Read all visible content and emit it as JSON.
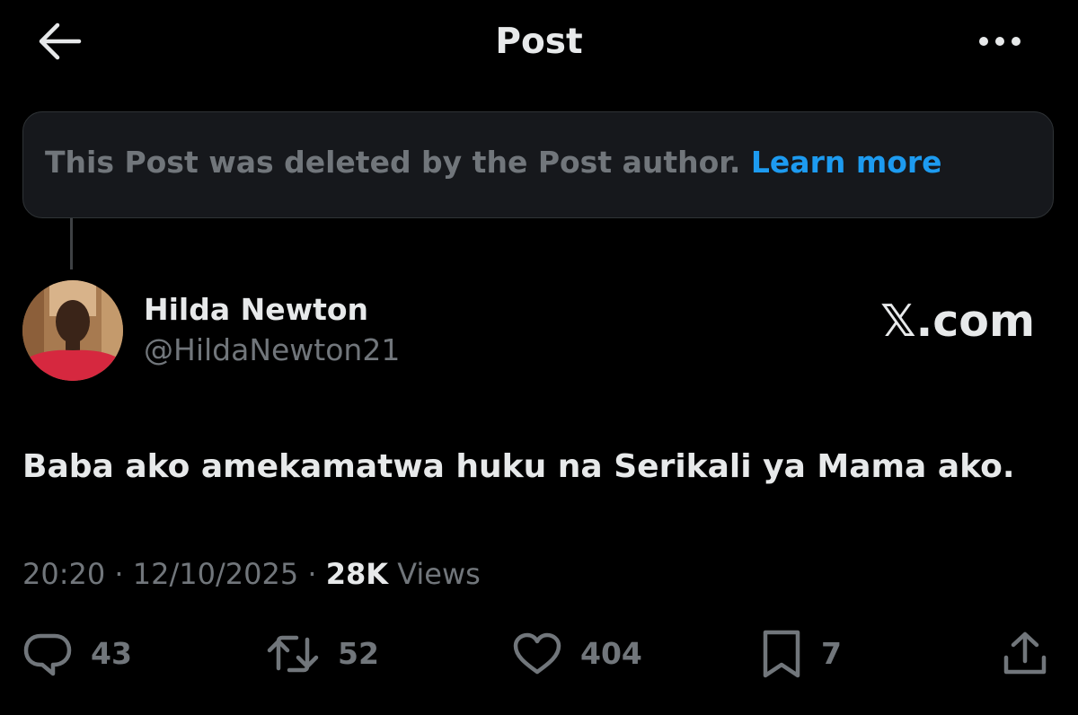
{
  "header": {
    "title": "Post",
    "back_icon": "arrow-left-icon",
    "more_icon": "more-horizontal-icon"
  },
  "deleted_notice": {
    "text": "This Post was deleted by the Post author.",
    "link": "Learn more"
  },
  "author": {
    "name": "Hilda Newton",
    "handle": "@HildaNewton21",
    "avatar_icon": "avatar"
  },
  "watermark": "𝕏.com",
  "post": {
    "text": "Baba ako amekamatwa huku na Serikali ya Mama ako."
  },
  "meta": {
    "time": "20:20",
    "separator": "·",
    "date": "12/10/2025",
    "views_count": "28K",
    "views_label": "Views"
  },
  "actions": {
    "replies": "43",
    "reposts": "52",
    "likes": "404",
    "bookmarks": "7"
  },
  "colors": {
    "background": "#000000",
    "text_primary": "#e7e9ea",
    "text_secondary": "#71767b",
    "link": "#1d9bf0",
    "notice_background": "#16181c"
  }
}
